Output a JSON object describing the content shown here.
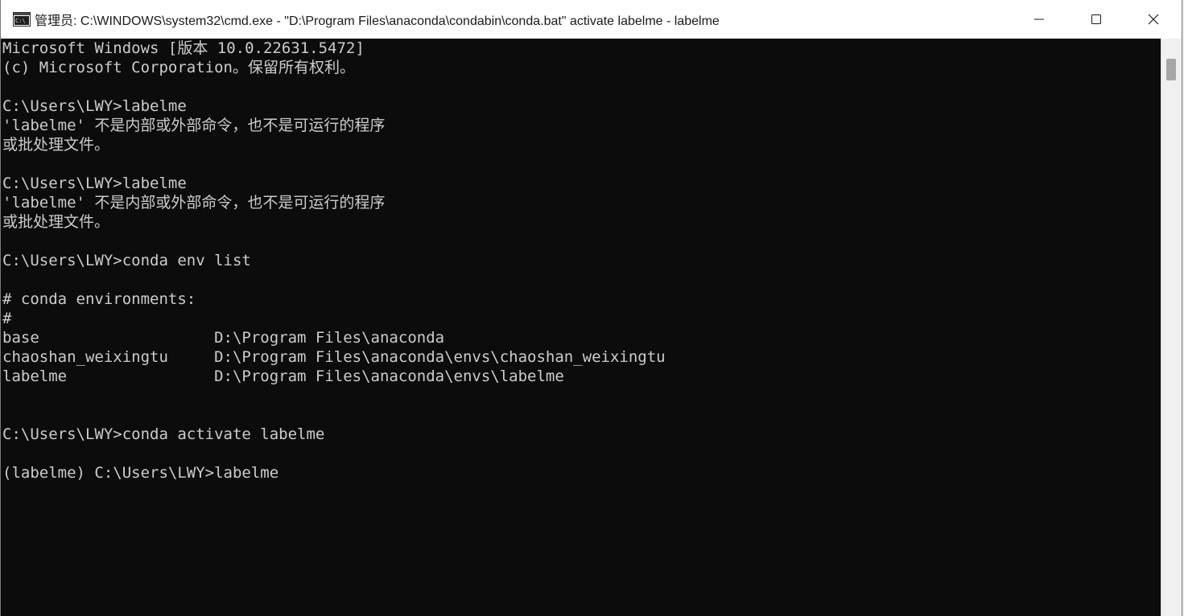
{
  "window": {
    "title": "管理员: C:\\WINDOWS\\system32\\cmd.exe - \"D:\\Program Files\\anaconda\\condabin\\conda.bat\"  activate labelme - labelme",
    "app_icon": "cmd-icon",
    "controls": {
      "minimize": "minimize-icon",
      "maximize": "maximize-icon",
      "close": "close-icon"
    }
  },
  "console": {
    "lines": [
      "Microsoft Windows [版本 10.0.22631.5472]",
      "(c) Microsoft Corporation。保留所有权利。",
      "",
      "C:\\Users\\LWY>labelme",
      "'labelme' 不是内部或外部命令，也不是可运行的程序",
      "或批处理文件。",
      "",
      "C:\\Users\\LWY>labelme",
      "'labelme' 不是内部或外部命令，也不是可运行的程序",
      "或批处理文件。",
      "",
      "C:\\Users\\LWY>conda env list",
      "",
      "# conda environments:",
      "#",
      "base                   D:\\Program Files\\anaconda",
      "chaoshan_weixingtu     D:\\Program Files\\anaconda\\envs\\chaoshan_weixingtu",
      "labelme                D:\\Program Files\\anaconda\\envs\\labelme",
      "",
      "",
      "C:\\Users\\LWY>conda activate labelme",
      "",
      "(labelme) C:\\Users\\LWY>labelme"
    ]
  },
  "colors": {
    "console_bg": "#0c0c0c",
    "console_fg": "#cccccc",
    "titlebar_bg": "#ffffff"
  }
}
